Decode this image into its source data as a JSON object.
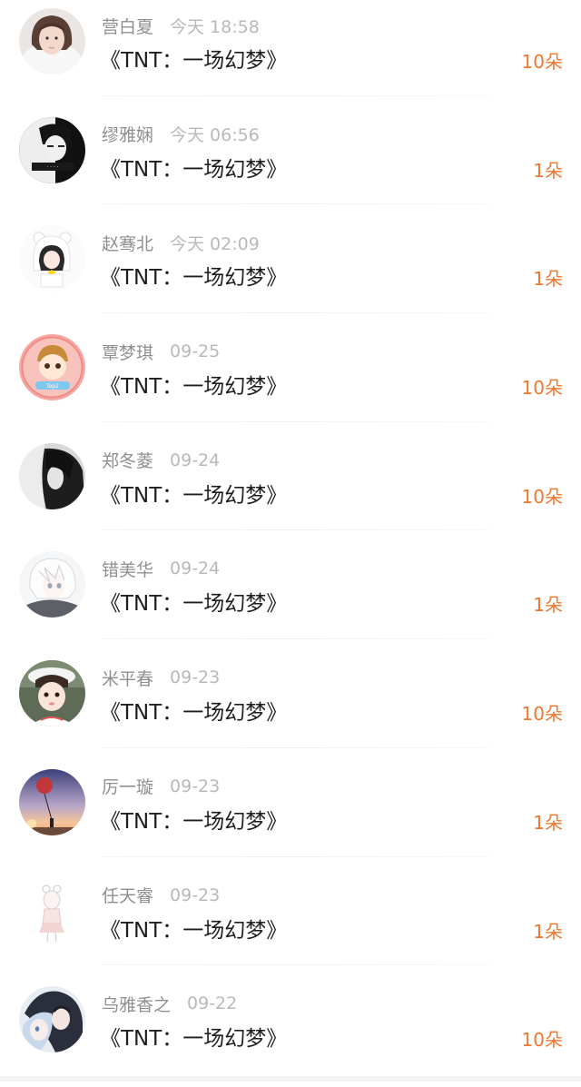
{
  "gift_records": [
    {
      "name": "营白夏",
      "time": "今天 18:58",
      "title": "《TNT：一场幻梦》",
      "amount": "10朵",
      "avatar": "girl-white-hood-avatar"
    },
    {
      "name": "缪雅娴",
      "time": "今天 06:56",
      "title": "《TNT：一场幻梦》",
      "amount": "1朵",
      "avatar": "monochrome-boy-avatar"
    },
    {
      "name": "赵骞北",
      "time": "今天 02:09",
      "title": "《TNT：一场幻梦》",
      "amount": "1朵",
      "avatar": "cartoon-bear-hood-avatar"
    },
    {
      "name": "覃梦琪",
      "time": "09-25",
      "title": "《TNT：一场幻梦》",
      "amount": "10朵",
      "avatar": "cartoon-boy-badge-avatar"
    },
    {
      "name": "郑冬菱",
      "time": "09-24",
      "title": "《TNT：一场幻梦》",
      "amount": "10朵",
      "avatar": "dark-hair-girl-avatar"
    },
    {
      "name": "错美华",
      "time": "09-24",
      "title": "《TNT：一场幻梦》",
      "amount": "1朵",
      "avatar": "anime-white-hair-avatar"
    },
    {
      "name": "米平春",
      "time": "09-23",
      "title": "《TNT：一场幻梦》",
      "amount": "10朵",
      "avatar": "girl-white-hat-avatar"
    },
    {
      "name": "厉一璇",
      "time": "09-23",
      "title": "《TNT：一场幻梦》",
      "amount": "1朵",
      "avatar": "balloon-sunset-avatar"
    },
    {
      "name": "任天睿",
      "time": "09-23",
      "title": "《TNT：一场幻梦》",
      "amount": "1朵",
      "avatar": "sketch-girl-avatar"
    },
    {
      "name": "乌雅香之",
      "time": "09-22",
      "title": "《TNT：一场幻梦》",
      "amount": "10朵",
      "avatar": "anime-blue-hair-avatar"
    }
  ],
  "colors": {
    "name": "#8f8f8f",
    "time": "#b9b9b9",
    "title": "#1e1e1e",
    "amount": "#f2762d"
  }
}
